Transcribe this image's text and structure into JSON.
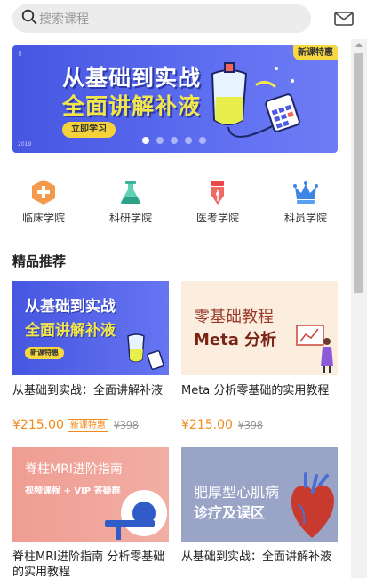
{
  "search": {
    "placeholder": "搜索课程",
    "icon": "search-icon"
  },
  "header": {
    "mail_icon": "mail-icon"
  },
  "banner": {
    "title_line1": "从基础到实战",
    "title_line2": "全面讲解补液",
    "button_label": "立即学习",
    "badge": "新课特惠",
    "year": "2019",
    "slide_count": 5,
    "active_slide": 1
  },
  "categories": [
    {
      "label": "临床学院",
      "icon": "plus-cross-icon",
      "color": "#f39a4c"
    },
    {
      "label": "科研学院",
      "icon": "flask-icon",
      "color": "#3cb39a"
    },
    {
      "label": "医考学院",
      "icon": "pen-icon",
      "color": "#e8484a"
    },
    {
      "label": "科员学院",
      "icon": "crown-icon",
      "color": "#3e86e4"
    }
  ],
  "section": {
    "title": "精品推荐"
  },
  "courses": [
    {
      "title": "从基础到实战：全面讲解补液",
      "price": "¥215.00",
      "tag": "新课特惠",
      "old_price": "¥398",
      "thumb": {
        "line1": "从基础到实战",
        "line2": "全面讲解补液",
        "badge": "新课特惠"
      }
    },
    {
      "title": "Meta 分析零基础的实用教程",
      "price": "¥215.00",
      "tag": "",
      "old_price": "¥398",
      "thumb": {
        "line1": "零基础教程",
        "line2": "Meta 分析"
      }
    },
    {
      "title": "脊柱MRI进阶指南 分析零基础的实用教程",
      "thumb": {
        "line1": "脊柱MRI进阶指南",
        "line2": "视频课程 + VIP 答疑群"
      }
    },
    {
      "title": "从基础到实战：全面讲解补液",
      "thumb": {
        "line1": "肥厚型心肌病",
        "line2": "诊疗及误区"
      }
    }
  ],
  "colors": {
    "accent": "#f08a1c",
    "banner_blue": "#4656e0",
    "highlight_yellow": "#f3e64a"
  }
}
